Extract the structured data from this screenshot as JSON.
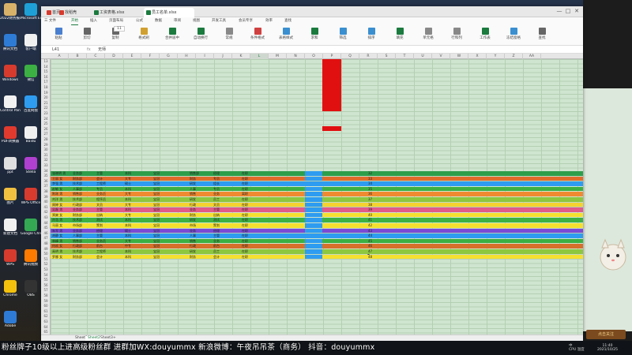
{
  "desktop": {
    "icons": [
      {
        "label": "2022财务报表",
        "color": "#d9b26a"
      },
      {
        "label": "腾讯文档",
        "color": "#2e7bd6"
      },
      {
        "label": "Windows",
        "color": "#d63b2e"
      },
      {
        "label": "Control Panel",
        "color": "#f2f2f2"
      },
      {
        "label": "PDF转换器",
        "color": "#e03a2f"
      },
      {
        "label": "ppt",
        "color": "#e0e0e0"
      },
      {
        "label": "图片",
        "color": "#f0c040"
      },
      {
        "label": "新建文档",
        "color": "#f0f0f0"
      },
      {
        "label": "WPS",
        "color": "#d63b2e"
      },
      {
        "label": "Chrome",
        "color": "#f4c20d"
      },
      {
        "label": "Adobe",
        "color": "#2e7bd6"
      },
      {
        "label": "Microsoft Edge",
        "color": "#1ea0d6"
      },
      {
        "label": "客户端",
        "color": "#f0f0f0"
      },
      {
        "label": "微信",
        "color": "#3cb043"
      },
      {
        "label": "百度网盘",
        "color": "#2e9cf0"
      },
      {
        "label": "Baidu",
        "color": "#f0f0f0"
      },
      {
        "label": "Stella",
        "color": "#b040d0"
      },
      {
        "label": "WPS Office",
        "color": "#d63b2e"
      },
      {
        "label": "Google Chrome",
        "color": "#34a853"
      },
      {
        "label": "腾讯视频",
        "color": "#ff7a00"
      },
      {
        "label": "OBS",
        "color": "#333333"
      }
    ]
  },
  "window": {
    "tabs": [
      {
        "label": "首页",
        "color": "#d63b2e"
      },
      {
        "label": "找稻壳",
        "color": "#d63b2e"
      },
      {
        "label": "工资表格.xlsx",
        "color": "#1b7a3e"
      },
      {
        "label": "员工名单.xlsx",
        "color": "#1b7a3e"
      }
    ],
    "controls": [
      "—",
      "□",
      "✕"
    ]
  },
  "ribbon": {
    "tabs": [
      "三 文件",
      "开始",
      "插入",
      "页面布局",
      "公式",
      "数据",
      "审阅",
      "视图",
      "开发工具",
      "会员专享",
      "效率",
      "查找"
    ],
    "active_tab": "开始",
    "font_size": "11",
    "buttons": [
      "粘贴",
      "剪切",
      "复制",
      "格式刷",
      "合并居中",
      "自动换行",
      "常规",
      "条件格式",
      "表格样式",
      "求和",
      "筛选",
      "排序",
      "填充",
      "单元格",
      "行和列",
      "工作表",
      "冻结窗格",
      "查找"
    ]
  },
  "formula_bar": {
    "name_box": "L41",
    "fx": "fx",
    "value": "无师"
  },
  "grid": {
    "columns": [
      "A",
      "B",
      "C",
      "D",
      "E",
      "F",
      "G",
      "H",
      "I",
      "J",
      "K",
      "L",
      "M",
      "N",
      "O",
      "P",
      "Q",
      "R",
      "S",
      "T",
      "U",
      "V",
      "W",
      "X",
      "Y",
      "Z",
      "AA"
    ],
    "row_numbers": [
      "13",
      "14",
      "15",
      "16",
      "17",
      "18",
      "19",
      "20",
      "21",
      "22",
      "23",
      "24",
      "25",
      "26",
      "27",
      "28",
      "29",
      "30",
      "31",
      "32",
      "33",
      "34",
      "35",
      "36",
      "37",
      "38",
      "39",
      "40",
      "41",
      "42",
      "43",
      "44",
      "45",
      "46",
      "47",
      "48",
      "49",
      "50",
      "51",
      "52",
      "53",
      "54",
      "55",
      "56",
      "57",
      "58",
      "59",
      "60",
      "61",
      "62",
      "63",
      "64",
      "65"
    ],
    "colored_rows": [
      {
        "color": "#2e9e4a",
        "cells": [
          "张晓明 男",
          "业务部",
          "主管",
          "本科",
          "宝冠",
          "销售部",
          "经理",
          "在职"
        ]
      },
      {
        "color": "#e06a2a",
        "cells": [
          "王丽 女",
          "财务部",
          "会计",
          "大专",
          "宝冠",
          "财务",
          "专员",
          "在职"
        ]
      },
      {
        "color": "#2e9cf0",
        "cells": [
          "李强 男",
          "技术部",
          "工程师",
          "硕士",
          "宝冠",
          "研发",
          "组长",
          "在职"
        ]
      },
      {
        "color": "#3cb043",
        "cells": [
          "赵敏 女",
          "人事部",
          "专员",
          "本科",
          "宝冠",
          "人事",
          "专员",
          "在职"
        ]
      },
      {
        "color": "#f08a30",
        "cells": [
          "陈刚 男",
          "销售部",
          "业务员",
          "大专",
          "宝冠",
          "销售",
          "业务",
          "离职"
        ]
      },
      {
        "color": "#8dc63f",
        "cells": [
          "刘洋 男",
          "技术部",
          "程序员",
          "本科",
          "宝冠",
          "研发",
          "员工",
          "在职"
        ]
      },
      {
        "color": "#f5d230",
        "cells": [
          "周婷 女",
          "行政部",
          "文员",
          "大专",
          "宝冠",
          "行政",
          "文员",
          "在职"
        ]
      },
      {
        "color": "#e05a8a",
        "cells": [
          "吴磊 男",
          "业务部",
          "主管",
          "本科",
          "宝冠",
          "业务",
          "主管",
          "在职"
        ]
      },
      {
        "color": "#f5e030",
        "cells": [
          "郑爽 女",
          "财务部",
          "出纳",
          "大专",
          "宝冠",
          "财务",
          "出纳",
          "在职"
        ]
      },
      {
        "color": "#3cb043",
        "cells": [
          "孙浩 男",
          "技术部",
          "测试",
          "本科",
          "宝冠",
          "研发",
          "测试",
          "在职"
        ]
      },
      {
        "color": "#f5e030",
        "cells": [
          "马丽 女",
          "市场部",
          "策划",
          "本科",
          "宝冠",
          "市场",
          "策划",
          "在职"
        ]
      },
      {
        "color": "#7a4ad6",
        "cells": [
          "朱军 男",
          "业务部",
          "经理",
          "硕士",
          "宝冠",
          "业务",
          "经理",
          "在职"
        ]
      },
      {
        "color": "#2e9cf0",
        "cells": [
          "胡静 女",
          "人事部",
          "主管",
          "本科",
          "宝冠",
          "人事",
          "主管",
          "在职"
        ]
      },
      {
        "color": "#3cb043",
        "cells": [
          "林峰 男",
          "销售部",
          "业务员",
          "大专",
          "宝冠",
          "销售",
          "业务",
          "在职"
        ]
      },
      {
        "color": "#d6702a",
        "cells": [
          "何欢 女",
          "行政部",
          "前台",
          "中专",
          "宝冠",
          "行政",
          "前台",
          "在职"
        ]
      },
      {
        "color": "#8dc63f",
        "cells": [
          "高明 男",
          "技术部",
          "工程师",
          "本科",
          "宝冠",
          "研发",
          "员工",
          "在职"
        ]
      },
      {
        "color": "#f5e030",
        "cells": [
          "罗娜 女",
          "财务部",
          "会计",
          "本科",
          "宝冠",
          "财务",
          "会计",
          "在职"
        ]
      }
    ],
    "row_numbers_right": [
      "32",
      "33",
      "34",
      "35",
      "36",
      "37",
      "38",
      "39",
      "40",
      "41",
      "42",
      "43",
      "44",
      "45",
      "46",
      "47",
      "48"
    ]
  },
  "sheets": [
    "Sheet1",
    "Sheet2",
    "Sheet3",
    "+"
  ],
  "active_sheet": "Sheet2",
  "banner": "粉丝牌子10级以上进高级粉丝群 进群加WX:douyummx 新浪微博：午夜吊吊茶（商务）   抖音：douyummx",
  "tray": {
    "time": "11:40",
    "date": "2021/10/25",
    "lang": "中",
    "extra": "CPU 温度"
  },
  "right_panel": {
    "badge": "点击关注"
  }
}
